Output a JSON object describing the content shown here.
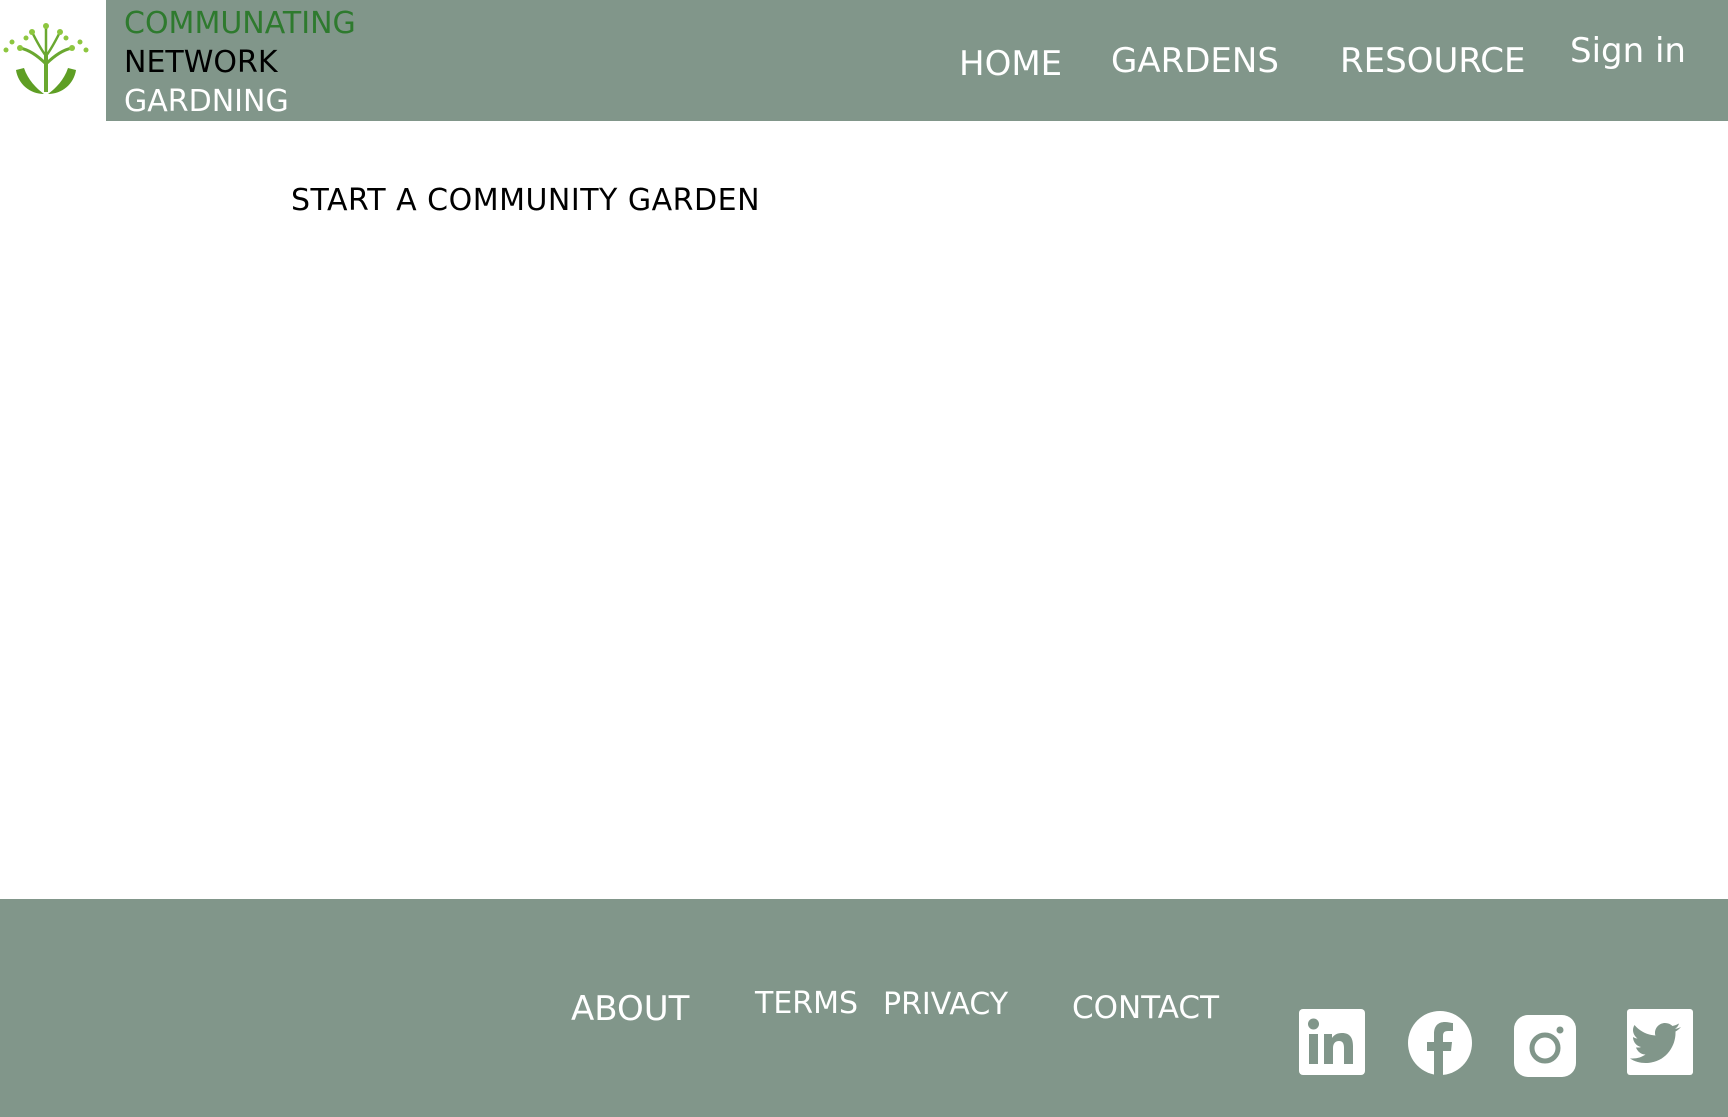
{
  "brand": {
    "line1": "COMMUNATING",
    "line2": "NETWORK",
    "line3": "GARDNING",
    "logo_icon": "tree-hands-logo-icon"
  },
  "nav": {
    "home": "HOME",
    "gardens": "GARDENS",
    "resource": "RESOURCE",
    "sign_in": "Sign in"
  },
  "main": {
    "heading": "START A COMMUNITY GARDEN"
  },
  "footer": {
    "about": "ABOUT",
    "terms": "TERMS",
    "privacy": "PRIVACY",
    "contact": "CONTACT",
    "social_icons": [
      "linkedin-icon",
      "facebook-icon",
      "instagram-icon",
      "twitter-icon"
    ]
  },
  "colors": {
    "header_bg": "#81968a",
    "footer_bg": "#81968a",
    "brand_green": "#2e7a2e",
    "logo_leaf": "#7cbf3c"
  }
}
